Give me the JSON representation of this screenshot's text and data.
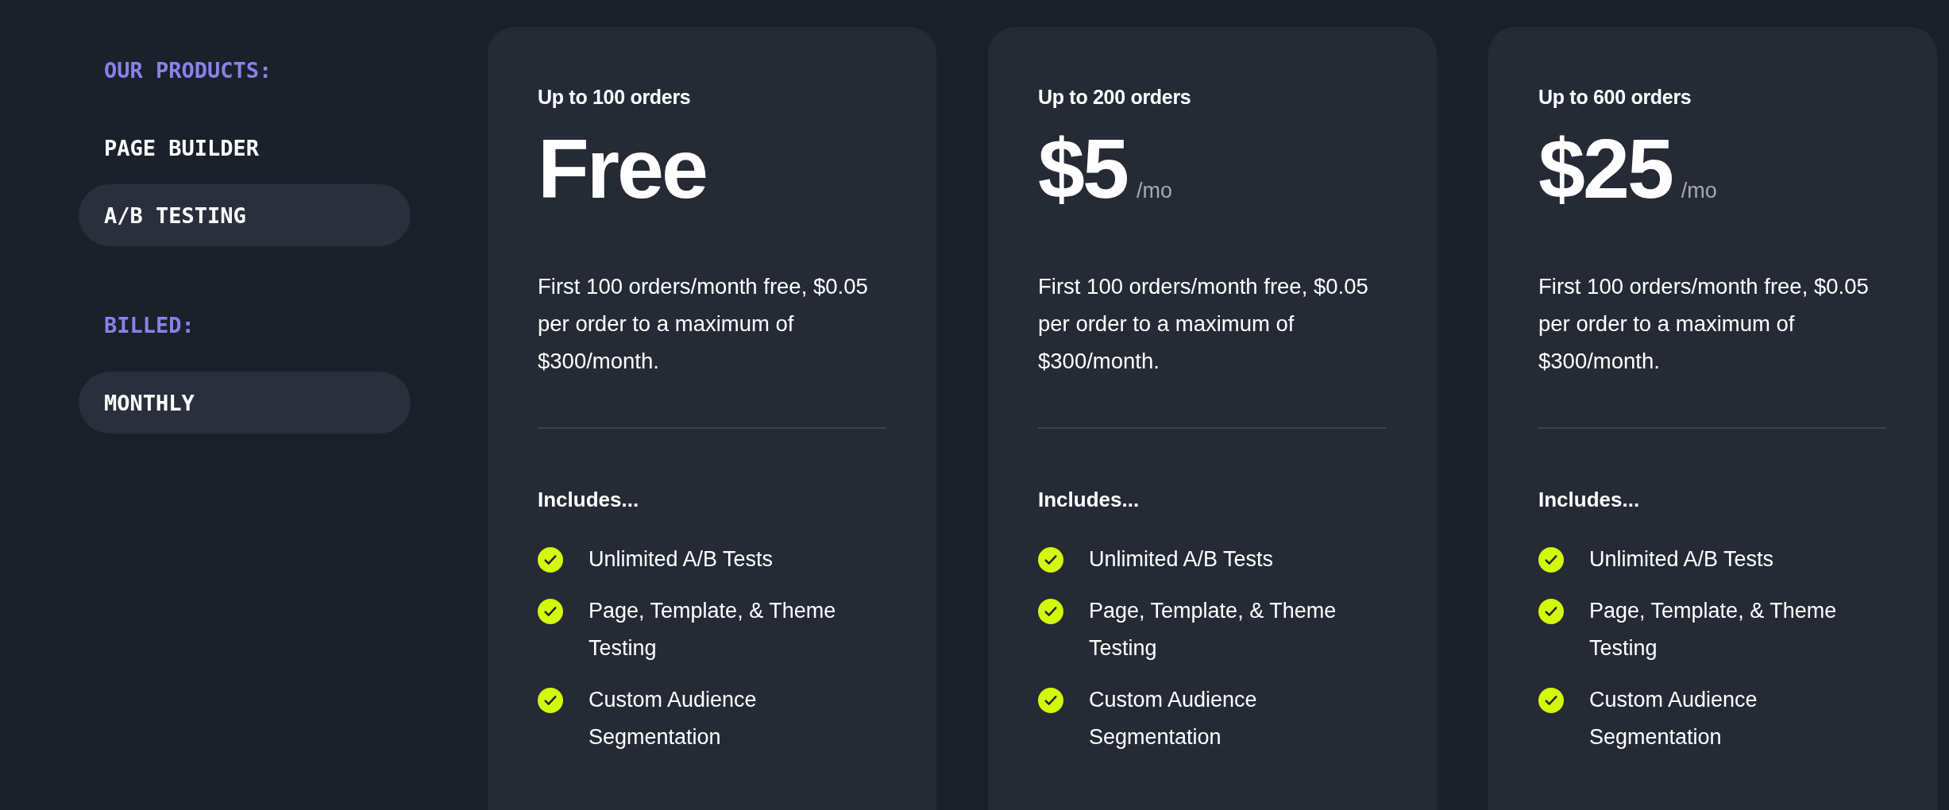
{
  "sidebar": {
    "sections": [
      {
        "heading": "OUR PRODUCTS:",
        "items": [
          {
            "label": "PAGE BUILDER",
            "selected": false
          },
          {
            "label": "A/B TESTING",
            "selected": true
          }
        ]
      },
      {
        "heading": "BILLED:",
        "items": [
          {
            "label": "MONTHLY",
            "selected": true
          }
        ]
      }
    ]
  },
  "plans": [
    {
      "limit": "Up to 100 orders",
      "price": "Free",
      "description": "First 100 orders/month free, $0.05 per order to a maximum of $300/month.",
      "includes_heading": "Includes...",
      "features": [
        "Unlimited A/B Tests",
        "Page, Template, & Theme Testing",
        "Custom Audience Segmentation"
      ]
    },
    {
      "limit": "Up to 200 orders",
      "price": "$5",
      "period": "/mo",
      "description": "First 100 orders/month free, $0.05 per order to a maximum of $300/month.",
      "includes_heading": "Includes...",
      "features": [
        "Unlimited A/B Tests",
        "Page, Template, & Theme Testing",
        "Custom Audience Segmentation"
      ]
    },
    {
      "limit": "Up to 600 orders",
      "price": "$25",
      "period": "/mo",
      "description": "First 100 orders/month free, $0.05 per order to a maximum of $300/month.",
      "includes_heading": "Includes...",
      "features": [
        "Unlimited A/B Tests",
        "Page, Template, & Theme Testing",
        "Custom Audience Segmentation"
      ]
    }
  ]
}
